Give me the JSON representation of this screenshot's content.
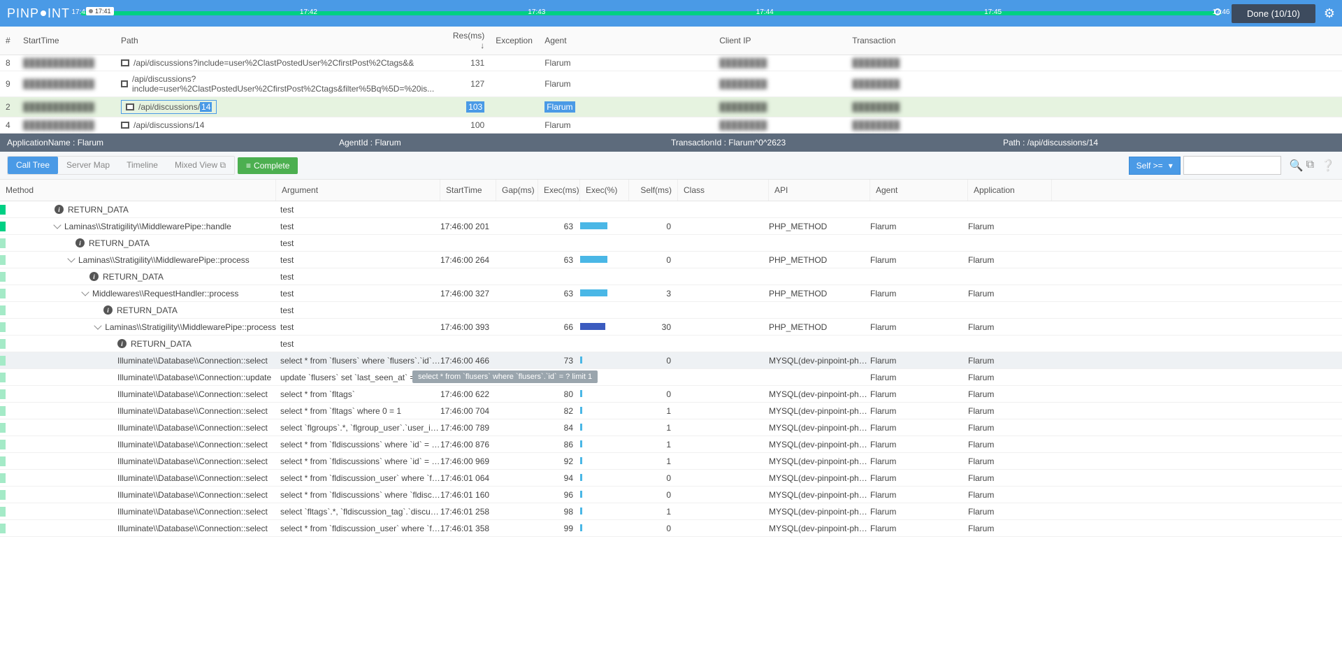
{
  "header": {
    "logo_pre": "PINP",
    "logo_post": "INT",
    "time_marker": "17:41",
    "ticks": [
      "17:41",
      "17:42",
      "17:43",
      "17:44",
      "17:45",
      "17:46"
    ],
    "done_label": "Done (10/10)"
  },
  "tx_cols": {
    "num": "#",
    "start": "StartTime",
    "path": "Path",
    "res": "Res(ms) ↓",
    "exc": "Exception",
    "agent": "Agent",
    "clientip": "Client IP",
    "txn": "Transaction"
  },
  "tx_rows": [
    {
      "n": "8",
      "start": "████████████",
      "path": "/api/discussions?include=user%2ClastPostedUser%2CfirstPost%2Ctags&&",
      "res": "131",
      "agent": "Flarum",
      "cip": "████████",
      "txn": "████████"
    },
    {
      "n": "9",
      "start": "████████████",
      "path": "/api/discussions?include=user%2ClastPostedUser%2CfirstPost%2Ctags&filter%5Bq%5D=%20is...",
      "res": "127",
      "agent": "Flarum",
      "cip": "████████",
      "txn": "████████"
    },
    {
      "n": "2",
      "start": "████████████",
      "path_pre": "/api/discussions/",
      "path_hl": "14",
      "res": "103",
      "agent": "Flarum",
      "cip": "████████",
      "txn": "████████",
      "sel": true
    },
    {
      "n": "4",
      "start": "████████████",
      "path": "/api/discussions/14",
      "res": "100",
      "agent": "Flarum",
      "cip": "████████",
      "txn": "████████"
    }
  ],
  "info": {
    "app": "ApplicationName : Flarum",
    "agent": "AgentId : Flarum",
    "txn": "TransactionId : Flarum^0^2623",
    "path": "Path : /api/discussions/14"
  },
  "tools": {
    "calltree": "Call Tree",
    "servermap": "Server Map",
    "timeline": "Timeline",
    "mixed": "Mixed View",
    "complete": "Complete",
    "filter": "Self >="
  },
  "ct_cols": {
    "method": "Method",
    "arg": "Argument",
    "start": "StartTime",
    "gap": "Gap(ms)",
    "exec": "Exec(ms)",
    "execp": "Exec(%)",
    "self": "Self(ms)",
    "class": "Class",
    "api": "API",
    "agent": "Agent",
    "app": "Application"
  },
  "tooltip_text": "select * from `flusers` where `flusers`.`id` = ? limit 1",
  "rows": [
    {
      "indent": 70,
      "icon": "info",
      "method": "RETURN_DATA",
      "arg": "test"
    },
    {
      "indent": 70,
      "chev": true,
      "method": "Laminas\\\\Stratigility\\\\MiddlewarePipe::handle",
      "arg": "test",
      "start": "17:46:00 201",
      "gap": "",
      "exec": "63",
      "execp": 39,
      "bar": "b",
      "self": "0",
      "api": "PHP_METHOD",
      "agent": "Flarum",
      "app": "Flarum"
    },
    {
      "indent": 100,
      "icon": "info",
      "method": "RETURN_DATA",
      "arg": "test"
    },
    {
      "indent": 90,
      "chev": true,
      "method": "Laminas\\\\Stratigility\\\\MiddlewarePipe::process",
      "arg": "test",
      "start": "17:46:00 264",
      "gap": "",
      "exec": "63",
      "execp": 39,
      "bar": "b",
      "self": "0",
      "api": "PHP_METHOD",
      "agent": "Flarum",
      "app": "Flarum"
    },
    {
      "indent": 120,
      "icon": "info",
      "method": "RETURN_DATA",
      "arg": "test"
    },
    {
      "indent": 110,
      "chev": true,
      "method": "Middlewares\\\\RequestHandler::process",
      "arg": "test",
      "start": "17:46:00 327",
      "gap": "",
      "exec": "63",
      "execp": 39,
      "bar": "b",
      "self": "3",
      "api": "PHP_METHOD",
      "agent": "Flarum",
      "app": "Flarum"
    },
    {
      "indent": 140,
      "icon": "info",
      "method": "RETURN_DATA",
      "arg": "test"
    },
    {
      "indent": 130,
      "chev": true,
      "method": "Laminas\\\\Stratigility\\\\MiddlewarePipe::process",
      "arg": "test",
      "start": "17:46:00 393",
      "gap": "",
      "exec": "66",
      "execp": 36,
      "bar": "d",
      "self": "30",
      "api": "PHP_METHOD",
      "agent": "Flarum",
      "app": "Flarum"
    },
    {
      "indent": 160,
      "icon": "info",
      "method": "RETURN_DATA",
      "arg": "test"
    },
    {
      "indent": 160,
      "method": "Illuminate\\\\Database\\\\Connection::select",
      "arg": "select * from `flusers` where `flusers`.`id` = ? ...",
      "start": "17:46:00 466",
      "gap": "",
      "exec": "73",
      "execp": 0,
      "bar": "t",
      "self": "0",
      "api": "MYSQL(dev-pinpoint-php-t...",
      "agent": "Flarum",
      "app": "Flarum",
      "hover": true
    },
    {
      "indent": 160,
      "method": "Illuminate\\\\Database\\\\Connection::update",
      "arg": "update `flusers` set `last_seen_at` = ? w",
      "start": "",
      "gap": "",
      "exec": "",
      "execp": 1,
      "bar": "t",
      "self": "",
      "api": "",
      "agent": "Flarum",
      "app": "Flarum",
      "tooltip": true
    },
    {
      "indent": 160,
      "method": "Illuminate\\\\Database\\\\Connection::select",
      "arg": "select * from `fltags`",
      "start": "17:46:00 622",
      "gap": "",
      "exec": "80",
      "execp": 0,
      "bar": "t",
      "self": "0",
      "api": "MYSQL(dev-pinpoint-php-t...",
      "agent": "Flarum",
      "app": "Flarum"
    },
    {
      "indent": 160,
      "method": "Illuminate\\\\Database\\\\Connection::select",
      "arg": "select * from `fltags` where 0 = 1",
      "start": "17:46:00 704",
      "gap": "",
      "exec": "82",
      "execp": 1,
      "bar": "t",
      "self": "1",
      "api": "MYSQL(dev-pinpoint-php-t...",
      "agent": "Flarum",
      "app": "Flarum"
    },
    {
      "indent": 160,
      "method": "Illuminate\\\\Database\\\\Connection::select",
      "arg": "select `flgroups`.*, `flgroup_user`.`user_id` a...",
      "start": "17:46:00 789",
      "gap": "",
      "exec": "84",
      "execp": 1,
      "bar": "t",
      "self": "1",
      "api": "MYSQL(dev-pinpoint-php-t...",
      "agent": "Flarum",
      "app": "Flarum"
    },
    {
      "indent": 160,
      "method": "Illuminate\\\\Database\\\\Connection::select",
      "arg": "select * from `fldiscussions` where `id` = ? an...",
      "start": "17:46:00 876",
      "gap": "",
      "exec": "86",
      "execp": 1,
      "bar": "t",
      "self": "1",
      "api": "MYSQL(dev-pinpoint-php-t...",
      "agent": "Flarum",
      "app": "Flarum"
    },
    {
      "indent": 160,
      "method": "Illuminate\\\\Database\\\\Connection::select",
      "arg": "select * from `fldiscussions` where `id` = ? an...",
      "start": "17:46:00 969",
      "gap": "",
      "exec": "92",
      "execp": 1,
      "bar": "t",
      "self": "1",
      "api": "MYSQL(dev-pinpoint-php-t...",
      "agent": "Flarum",
      "app": "Flarum"
    },
    {
      "indent": 160,
      "method": "Illuminate\\\\Database\\\\Connection::select",
      "arg": "select * from `fldiscussion_user` where `fldisc...",
      "start": "17:46:01 064",
      "gap": "",
      "exec": "94",
      "execp": 0,
      "bar": "t",
      "self": "0",
      "api": "MYSQL(dev-pinpoint-php-t...",
      "agent": "Flarum",
      "app": "Flarum"
    },
    {
      "indent": 160,
      "method": "Illuminate\\\\Database\\\\Connection::select",
      "arg": "select * from `fldiscussions` where `fldiscussio...",
      "start": "17:46:01 160",
      "gap": "",
      "exec": "96",
      "execp": 0,
      "bar": "t",
      "self": "0",
      "api": "MYSQL(dev-pinpoint-php-t...",
      "agent": "Flarum",
      "app": "Flarum"
    },
    {
      "indent": 160,
      "method": "Illuminate\\\\Database\\\\Connection::select",
      "arg": "select `fltags`.*, `fldiscussion_tag`.`discussion...",
      "start": "17:46:01 258",
      "gap": "",
      "exec": "98",
      "execp": 1,
      "bar": "t",
      "self": "1",
      "api": "MYSQL(dev-pinpoint-php-t...",
      "agent": "Flarum",
      "app": "Flarum"
    },
    {
      "indent": 160,
      "method": "Illuminate\\\\Database\\\\Connection::select",
      "arg": "select * from `fldiscussion_user` where `fldisc...",
      "start": "17:46:01 358",
      "gap": "",
      "exec": "99",
      "execp": 0,
      "bar": "t",
      "self": "0",
      "api": "MYSQL(dev-pinpoint-php-t...",
      "agent": "Flarum",
      "app": "Flarum"
    }
  ]
}
